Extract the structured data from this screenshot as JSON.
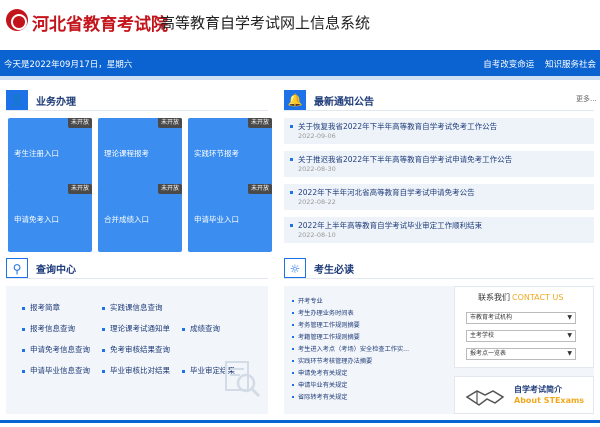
{
  "header": {
    "org_name": "河北省教育考试院",
    "system_name": "高等教育自学考试网上信息系统"
  },
  "topbar": {
    "date_text": "今天是2022年09月17日，星期六",
    "link_1": "自考改变命运",
    "link_2": "知识服务社会"
  },
  "business": {
    "title": "业务办理",
    "tiles": [
      {
        "label": "考生注册入口",
        "badge": "未开放"
      },
      {
        "label": "理论课程报考",
        "badge": "未开放"
      },
      {
        "label": "实践环节报考",
        "badge": "未开放"
      },
      {
        "label": "申请免考入口",
        "badge": "未开放"
      },
      {
        "label": "合并成绩入口",
        "badge": "未开放"
      },
      {
        "label": "申请毕业入口",
        "badge": "未开放"
      }
    ]
  },
  "notices": {
    "title": "最新通知公告",
    "more": "更多...",
    "items": [
      {
        "title": "关于恢复我省2022年下半年高等教育自学考试免考工作公告",
        "date": "2022-09-06"
      },
      {
        "title": "关于推迟我省2022年下半年高等教育自学考试申请免考工作公告",
        "date": "2022-08-30"
      },
      {
        "title": "2022年下半年河北省高等教育自学考试申请免考公告",
        "date": "2022-08-22"
      },
      {
        "title": "2022年上半年高等教育自学考试毕业审定工作顺利结束",
        "date": "2022-08-10"
      }
    ]
  },
  "query": {
    "title": "查询中心",
    "items": [
      "报考简章",
      "实践课信息查询",
      "报考信息查询",
      "理论课考试通知单",
      "成绩查询",
      "申请免考信息查询",
      "免考审核结果查询",
      "申请毕业信息查询",
      "毕业审核比对结果",
      "毕业审定结果"
    ]
  },
  "must_read": {
    "title": "考生必读",
    "items": [
      "开考专业",
      "考生办理业务时间表",
      "考务管理工作规则摘要",
      "考籍管理工作规则摘要",
      "考生进入考点（考场）安全检查工作实...",
      "实践环节考核管理办法摘要",
      "申请免考有关规定",
      "申请毕业有关规定",
      "省际转考有关规定"
    ]
  },
  "contact": {
    "title_cn": "联系我们",
    "title_en": "CONTACT US",
    "select_1": "市教育考试机构",
    "select_2": "主考学校",
    "select_3": "报考点一览表"
  },
  "intro": {
    "title": "自学考试简介",
    "subtitle": "About STExams"
  },
  "colors": {
    "brand_red": "#c4141b",
    "topbar_blue": "#0b63d1",
    "tile_blue": "#3b8ef0",
    "accent_orange": "#f1a91e"
  }
}
